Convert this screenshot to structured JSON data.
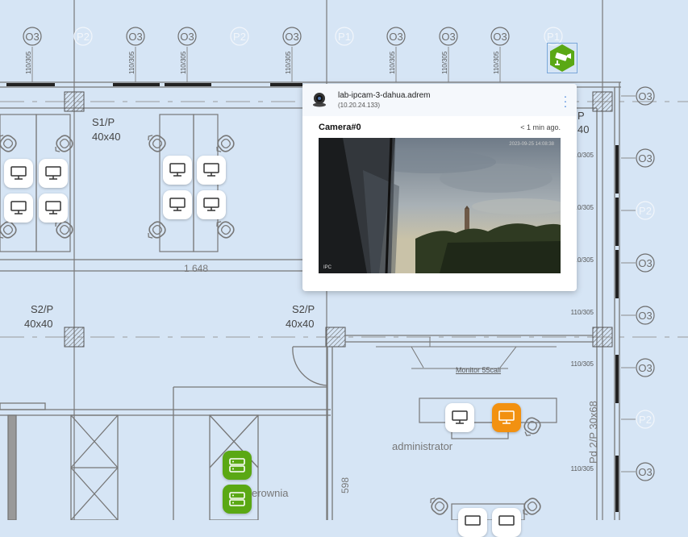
{
  "plan": {
    "column_labels": [
      "O3",
      "P2",
      "O3",
      "O3",
      "P2",
      "O3",
      "P1",
      "O3",
      "O3",
      "O3",
      "P1"
    ],
    "right_labels": [
      "O3",
      "O3",
      "P2",
      "O3",
      "O3",
      "O3",
      "P2",
      "O3"
    ],
    "dim_labels": [
      "110/305",
      "110/305",
      "110/305",
      "110/305",
      "110/305",
      "110/305",
      "110/305"
    ],
    "right_dim_labels": [
      "110/305",
      "110/305",
      "110/305",
      "110/305",
      "110/305",
      "110/305",
      "110/305"
    ],
    "pillar_1": "S1/P",
    "pillar_1_size": "40x40",
    "pillar_2": "S2/P",
    "pillar_2_size": "40x40",
    "pillar_3": "S2/P",
    "pillar_3_size": "40x40",
    "width_label": "1 648",
    "monitor_label": "Monitor 55cali",
    "room_admin": "administrator",
    "room_server": "erownia",
    "side_label": "Pd 2/P 30x68",
    "height_label": "598",
    "partial_40": "40",
    "partial_p": "P"
  },
  "popup": {
    "device_name": "lab-ipcam-3-dahua.adrem",
    "device_ip": "(10.20.24.133)",
    "camera_title": "Camera#0",
    "camera_age": "< 1 min ago.",
    "overlay_label": "IPC",
    "overlay_time": "2023-09-25 14:08:38"
  },
  "colors": {
    "background": "#d6e5f5",
    "line": "#6f6f6f",
    "accent_green": "#5aa814",
    "accent_orange": "#f29111",
    "menu_blue": "#3b7dd8"
  },
  "icons": {
    "workstation": "monitor-icon",
    "server": "server-icon",
    "camera": "security-camera-icon",
    "menu": "kebab-menu-icon"
  }
}
